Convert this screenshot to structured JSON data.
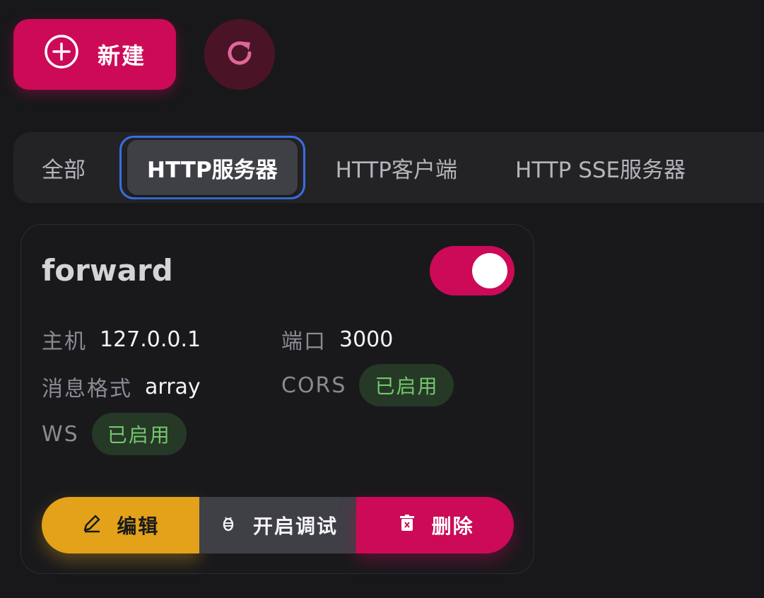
{
  "toolbar": {
    "new_label": "新建"
  },
  "tabs": [
    {
      "label": "全部"
    },
    {
      "label": "HTTP服务器",
      "active": true
    },
    {
      "label": "HTTP客户端"
    },
    {
      "label": "HTTP SSE服务器"
    }
  ],
  "card": {
    "title": "forward",
    "enabled": true,
    "host_label": "主机",
    "host_value": "127.0.0.1",
    "port_label": "端口",
    "port_value": "3000",
    "format_label": "消息格式",
    "format_value": "array",
    "cors_label": "CORS",
    "cors_status": "已启用",
    "ws_label": "WS",
    "ws_status": "已启用",
    "edit_label": "编辑",
    "debug_label": "开启调试",
    "delete_label": "删除"
  },
  "colors": {
    "accent": "#cc0a57",
    "warning": "#e3a21a",
    "success": "#72c86e",
    "tab_focus": "#3b6ee0"
  }
}
